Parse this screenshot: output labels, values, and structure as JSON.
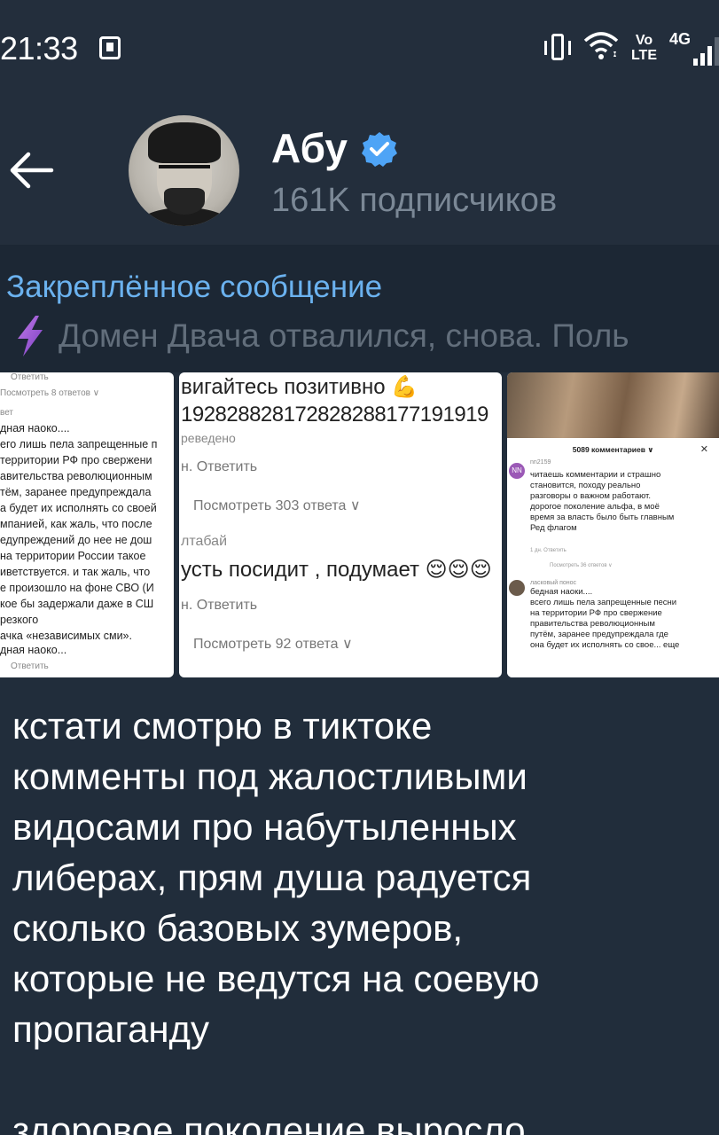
{
  "status_bar": {
    "time": "21:33",
    "volte_line1": "Vo",
    "volte_line2": "LTE",
    "network": "4G",
    "icons": [
      "screen-record-icon",
      "vibrate-icon",
      "wifi-icon",
      "signal-icon"
    ]
  },
  "header": {
    "channel_name": "Абу",
    "verified": true,
    "subscribers": "161K подписчиков"
  },
  "pinned": {
    "title": "Закреплённое сообщение",
    "icon": "lightning-icon",
    "text": "Домен Двача отвалился, снова.  Поль"
  },
  "media": {
    "tile1": {
      "lines": [
        "Ответить",
        "Посмотреть 8 ответов ∨",
        "вет",
        "дная наоко....",
        "его лишь пела запрещенные п",
        "территории РФ про свержени",
        "авительства революционным",
        "тём, заранее предупреждала",
        "а будет их исполнять со своей",
        "мпанией, как жаль, что после",
        "едупреждений до нее не дош",
        "на территории России такое",
        "иветствуется. и так жаль, что",
        "е произошло на фоне СВО (И",
        "кое бы задержали даже в СШ",
        "резкого",
        "ачка «независимых сми».",
        "дная наоко...",
        "Ответить"
      ]
    },
    "tile2": {
      "line1": "вигайтесь позитивно 💪",
      "line2": "192828828172828288177191919",
      "line3": "реведено",
      "reply1": "н.   Ответить",
      "views1": "Посмотреть 303 ответа ∨",
      "user2": "лтабай",
      "line4": "усть посидит , подумает 😌😌😌",
      "reply2": "н.   Ответить",
      "views2": "Посмотреть 92 ответа ∨"
    },
    "tile3": {
      "header": "5089 комментариев ∨",
      "close": "✕",
      "c1_avatar_text": "NN",
      "c1_nick": "nn2159",
      "c1_lines": [
        "читаешь комментарии и страшно",
        "становится, походу реально",
        "разговоры о важном работают.",
        "дорогое поколение альфа, в моё",
        "время за власть было быть главным",
        "Ред флагом"
      ],
      "c1_meta": "1 дн.   Ответить",
      "c1_more": "Посмотреть 36 ответов ∨",
      "c2_nick": "ласковый понос",
      "c2_lines": [
        "бедная наоки....",
        "всего лишь пела запрещенные песни",
        "на территории РФ про свержение",
        "правительства революционным",
        "путём, заранее предупреждала где",
        "она будет их исполнять со свое... еще"
      ]
    }
  },
  "message": {
    "lines": [
      "кстати смотрю в тиктоке",
      "комменты под жалостливыми",
      "видосами про набутыленных",
      "либерах, прям душа радуется",
      "сколько базовых зумеров,",
      "которые не ведутся на соевую",
      "пропаганду",
      "",
      "здоровое поколение выросло"
    ]
  },
  "colors": {
    "background": "#212d3b",
    "header_bg": "#232e3c",
    "pinned_bg": "#1c2734",
    "accent": "#6bb2ef",
    "muted": "#7b8896",
    "verified": "#4ea4f6"
  }
}
